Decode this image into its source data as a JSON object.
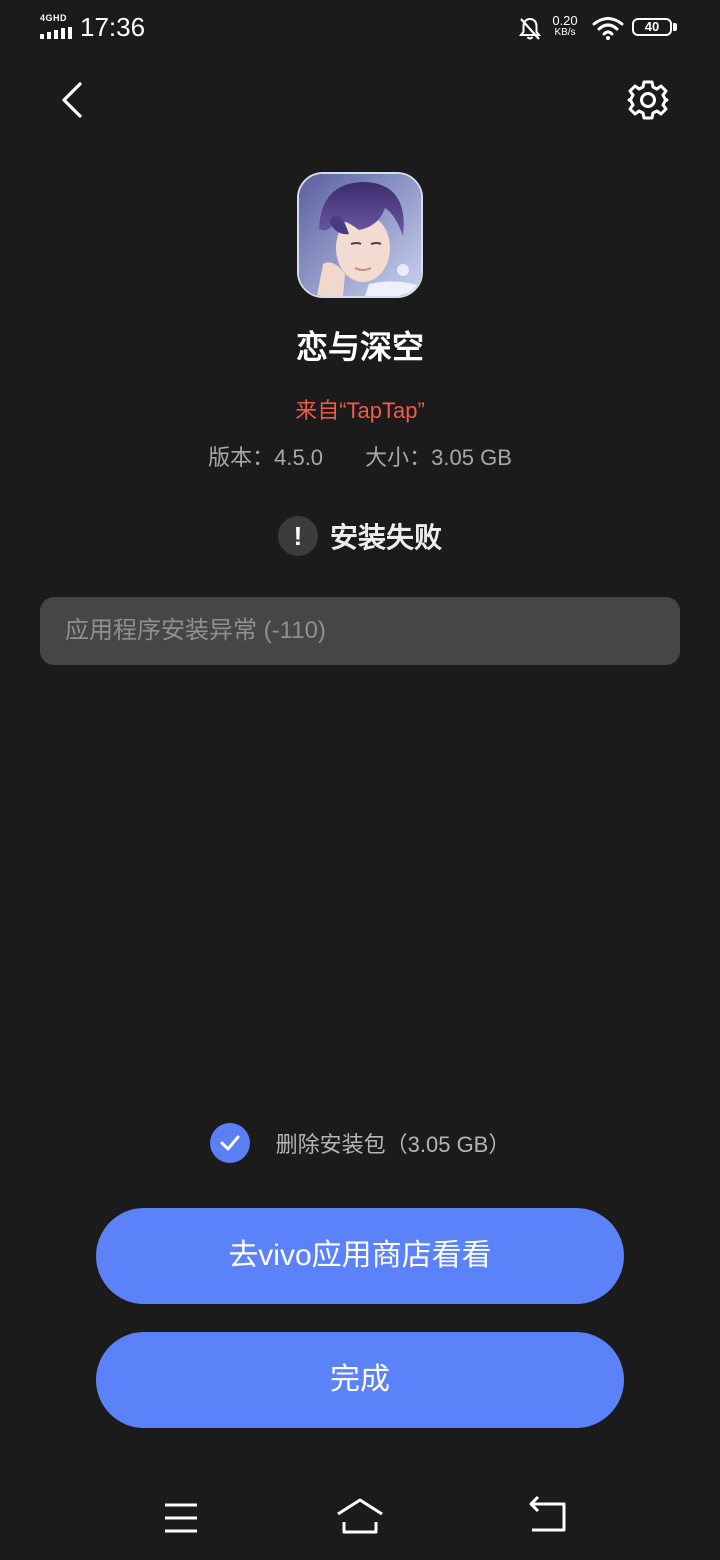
{
  "status_bar": {
    "network_label": "4GHD",
    "time": "17:36",
    "net_speed_value": "0.20",
    "net_speed_unit": "KB/s",
    "battery": "40"
  },
  "header": {
    "back_icon": "chevron-left-icon",
    "settings_icon": "gear-icon"
  },
  "app": {
    "name": "恋与深空",
    "source": "来自“TapTap”",
    "version": "版本：4.5.0",
    "size": "大小：3.05 GB"
  },
  "install_status": {
    "icon": "exclamation-icon",
    "text": "安装失败",
    "error_message": "应用程序安装异常 (-110)"
  },
  "actions": {
    "delete_package_checked": true,
    "delete_package_label": "删除安装包（3.05 GB）",
    "store_button_label": "去vivo应用商店看看",
    "done_button_label": "完成"
  },
  "nav_bar": {
    "menu_icon": "menu-icon",
    "home_icon": "home-icon",
    "back_icon": "return-icon"
  },
  "colors": {
    "background": "#1b1b1b",
    "accent": "#5b82f8",
    "source_red": "#f05a4a",
    "error_box": "#464646"
  }
}
